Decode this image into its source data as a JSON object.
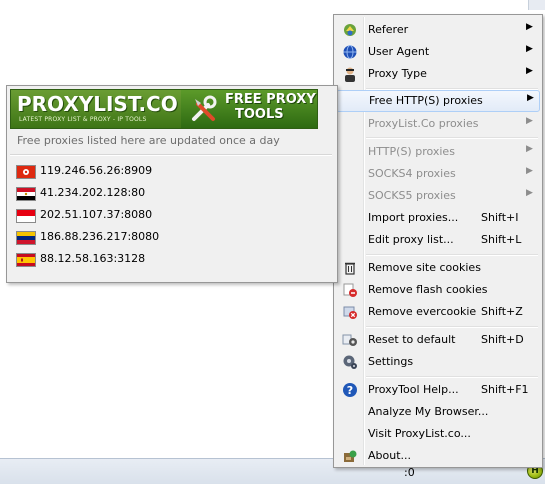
{
  "statusbar": {
    "count_text": ":0",
    "badge": "H"
  },
  "menu": {
    "items": [
      {
        "label": "Referer",
        "icon": "referer-icon",
        "arrow": "▶"
      },
      {
        "label": "User Agent",
        "icon": "user-agent-icon",
        "arrow": "▶"
      },
      {
        "label": "Proxy Type",
        "icon": "proxy-type-icon",
        "arrow": "▶"
      },
      {
        "label": "Free HTTP(S) proxies",
        "arrow": "▶"
      },
      {
        "label": "ProxyList.Co proxies",
        "arrow": "▶"
      },
      {
        "label": "HTTP(S) proxies",
        "arrow": "▶"
      },
      {
        "label": "SOCKS4 proxies",
        "arrow": "▶"
      },
      {
        "label": "SOCKS5 proxies",
        "arrow": "▶"
      },
      {
        "label": "Import proxies...",
        "shortcut": "Shift+I"
      },
      {
        "label": "Edit proxy list...",
        "shortcut": "Shift+L"
      },
      {
        "label": "Remove site cookies",
        "icon": "trash-icon"
      },
      {
        "label": "Remove flash cookies",
        "icon": "flash-cookie-icon"
      },
      {
        "label": "Remove evercookie",
        "icon": "evercookie-icon",
        "shortcut": "Shift+Z"
      },
      {
        "label": "Reset to default",
        "icon": "reset-icon",
        "shortcut": "Shift+D"
      },
      {
        "label": "Settings",
        "icon": "settings-icon"
      },
      {
        "label": "ProxyTool Help...",
        "icon": "help-icon",
        "shortcut": "Shift+F1"
      },
      {
        "label": "Analyze My Browser..."
      },
      {
        "label": "Visit ProxyList.co..."
      },
      {
        "label": "About...",
        "icon": "about-icon"
      }
    ]
  },
  "submenu": {
    "brand": "PROXYLIST.CO",
    "tagline": "LATEST PROXY LIST & PROXY - IP TOOLS",
    "tools_title_1": "FREE PROXY",
    "tools_title_2": "TOOLS",
    "note": "Free proxies listed here are updated once a day",
    "proxies": [
      {
        "address": "119.246.56.26:8909",
        "flag": "hong-kong-flag"
      },
      {
        "address": "41.234.202.128:80",
        "flag": "egypt-flag"
      },
      {
        "address": "202.51.107.37:8080",
        "flag": "indonesia-flag"
      },
      {
        "address": "186.88.236.217:8080",
        "flag": "venezuela-flag"
      },
      {
        "address": "88.12.58.163:3128",
        "flag": "spain-flag"
      }
    ]
  }
}
